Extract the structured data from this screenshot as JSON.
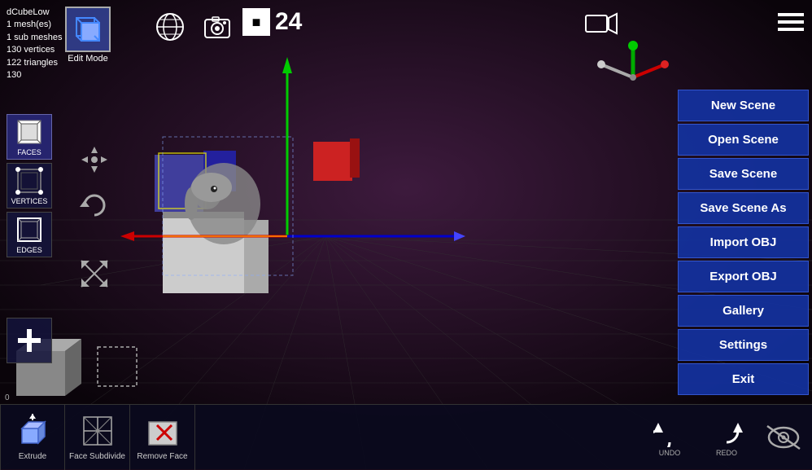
{
  "info": {
    "mesh_name": "dCubeLow",
    "meshes": "1 mesh(es)",
    "sub_meshes": "1 sub meshes",
    "vertices": "130 vertices",
    "triangles": "122 triangles",
    "extra": "130"
  },
  "toolbar": {
    "edit_mode_label": "Edit Mode",
    "frame_number": "24",
    "frame_box_color": "#ffffff"
  },
  "left_sidebar": {
    "faces_label": "FACES",
    "vertices_label": "VERTICES",
    "edges_label": "EDGES"
  },
  "bottom_toolbar": {
    "extrude_label": "Extrude",
    "face_subdivide_label": "Face Subdivide",
    "remove_face_label": "Remove Face",
    "undo_label": "UNDO",
    "redo_label": "REDO"
  },
  "right_menu": {
    "new_scene": "New Scene",
    "open_scene": "Open Scene",
    "save_scene": "Save Scene",
    "save_scene_as": "Save Scene As",
    "import_obj": "Import OBJ",
    "export_obj": "Export OBJ",
    "gallery": "Gallery",
    "settings": "Settings",
    "exit": "Exit"
  },
  "coord_bar": {
    "text": "0"
  },
  "colors": {
    "menu_bg": "#1432a0",
    "menu_border": "#3355cc",
    "sidebar_bg": "#141440",
    "active_sidebar": "#282878"
  }
}
